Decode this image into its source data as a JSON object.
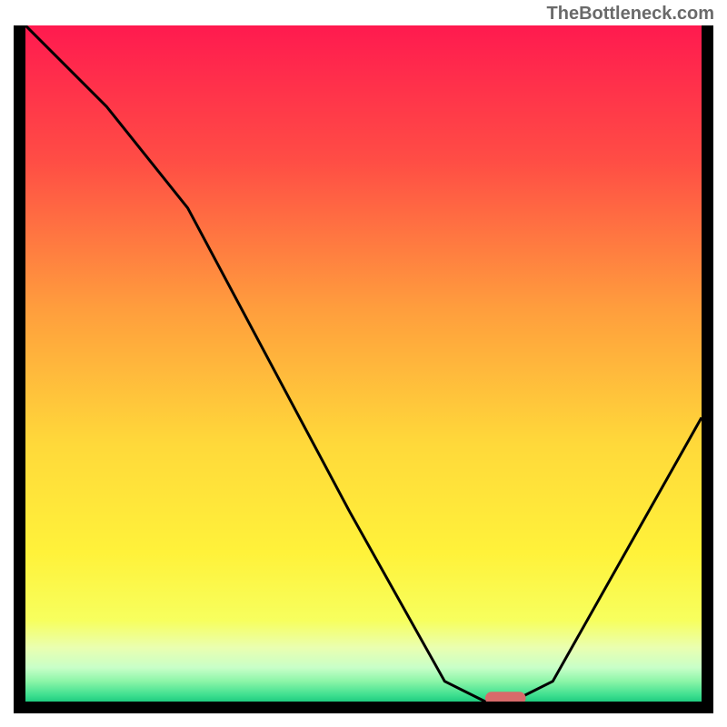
{
  "watermark": "TheBottleneck.com",
  "chart_data": {
    "type": "line",
    "title": "",
    "xlabel": "",
    "ylabel": "",
    "xlim": [
      0,
      100
    ],
    "ylim": [
      0,
      100
    ],
    "x": [
      0,
      12,
      24,
      48,
      62,
      68,
      72,
      78,
      100
    ],
    "values": [
      100,
      88,
      73,
      28,
      3,
      0,
      0,
      3,
      42
    ],
    "marker": {
      "x_start": 68,
      "x_end": 74,
      "y": 0.5
    },
    "background_gradient": {
      "stops": [
        {
          "offset": 0,
          "color": "#ff1a4f"
        },
        {
          "offset": 20,
          "color": "#ff4d45"
        },
        {
          "offset": 42,
          "color": "#ff9e3d"
        },
        {
          "offset": 62,
          "color": "#ffd93a"
        },
        {
          "offset": 78,
          "color": "#fff23a"
        },
        {
          "offset": 88,
          "color": "#f7ff5e"
        },
        {
          "offset": 92,
          "color": "#eaffb0"
        },
        {
          "offset": 95,
          "color": "#c8ffc8"
        },
        {
          "offset": 97,
          "color": "#8cf5a8"
        },
        {
          "offset": 99,
          "color": "#40e090"
        },
        {
          "offset": 100,
          "color": "#20cc80"
        }
      ]
    }
  }
}
